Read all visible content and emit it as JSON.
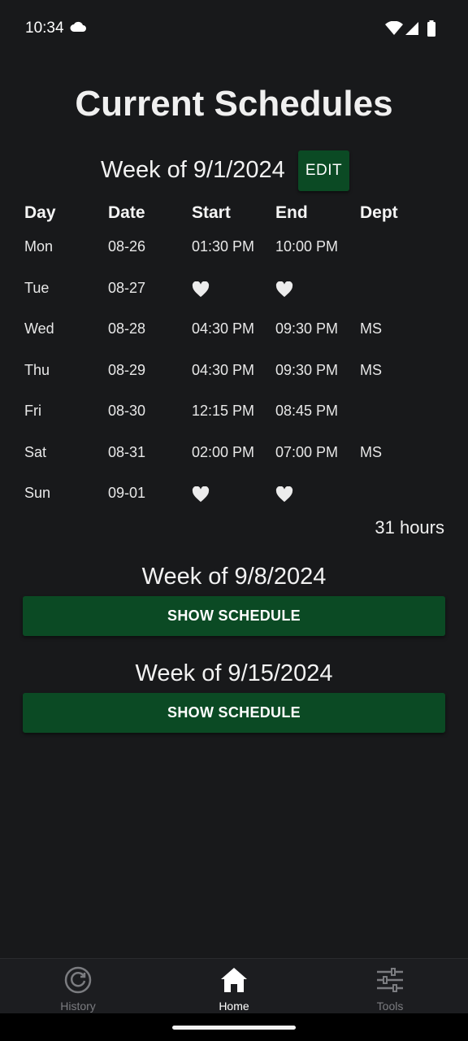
{
  "status_bar": {
    "time": "10:34"
  },
  "title": "Current Schedules",
  "week1": {
    "label": "Week of 9/1/2024",
    "edit_label": "EDIT",
    "columns": [
      "Day",
      "Date",
      "Start",
      "End",
      "Dept"
    ],
    "rows": [
      {
        "day": "Mon",
        "date": "08-26",
        "start": "01:30 PM",
        "end": "10:00 PM",
        "dept": ""
      },
      {
        "day": "Tue",
        "date": "08-27",
        "start": "",
        "end": "",
        "dept": ""
      },
      {
        "day": "Wed",
        "date": "08-28",
        "start": "04:30 PM",
        "end": "09:30 PM",
        "dept": "MS"
      },
      {
        "day": "Thu",
        "date": "08-29",
        "start": "04:30 PM",
        "end": "09:30 PM",
        "dept": "MS"
      },
      {
        "day": "Fri",
        "date": "08-30",
        "start": "12:15 PM",
        "end": "08:45 PM",
        "dept": ""
      },
      {
        "day": "Sat",
        "date": "08-31",
        "start": "02:00 PM",
        "end": "07:00 PM",
        "dept": "MS"
      },
      {
        "day": "Sun",
        "date": "09-01",
        "start": "",
        "end": "",
        "dept": ""
      }
    ],
    "total": "31 hours"
  },
  "week2": {
    "label": "Week of 9/8/2024",
    "button_label": "SHOW SCHEDULE"
  },
  "week3": {
    "label": "Week of 9/15/2024",
    "button_label": "SHOW SCHEDULE"
  },
  "nav": {
    "items": [
      {
        "label": "History",
        "icon": "history-icon"
      },
      {
        "label": "Home",
        "icon": "home-icon"
      },
      {
        "label": "Tools",
        "icon": "tools-icon"
      }
    ],
    "active": "Home"
  },
  "colors": {
    "background": "#18191b",
    "accent_green": "#0b4a24",
    "nav_inactive": "#7b7c80"
  }
}
